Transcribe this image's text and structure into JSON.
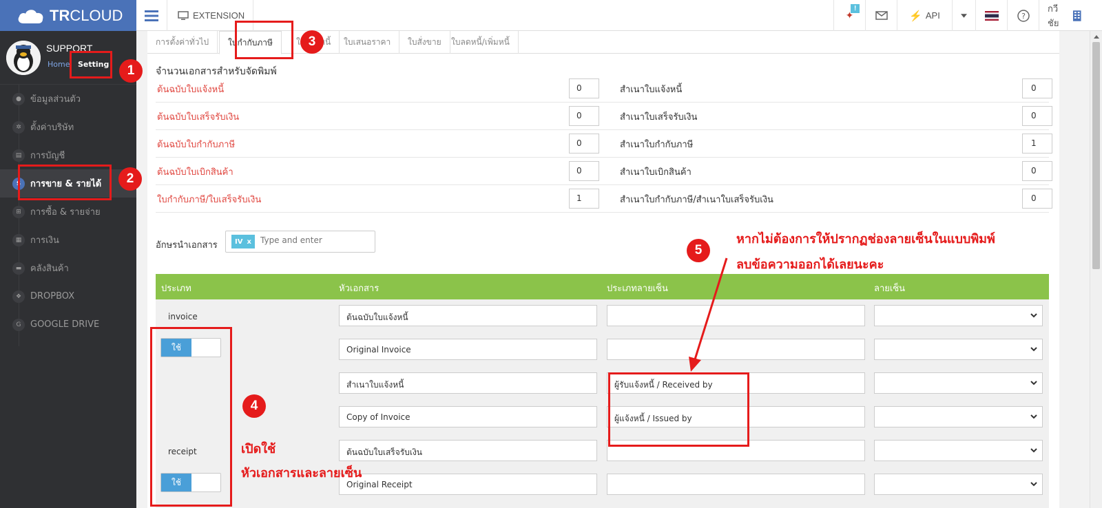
{
  "brand": {
    "logo_bold": "TR",
    "logo_rest": "CLOUD"
  },
  "topbar": {
    "extension_label": "EXTENSION",
    "notification_count": "!",
    "api_label": "API",
    "user_name": "กวีชัย"
  },
  "sidebar": {
    "profile_name": "SUPPORT",
    "home_link": "Home",
    "setting_link": "Setting",
    "items": [
      {
        "label": "ข้อมูลส่วนตัว",
        "icon": "user-icon",
        "glyph": "●"
      },
      {
        "label": "ตั้งค่าบริษัท",
        "icon": "gear-icon",
        "glyph": "✲"
      },
      {
        "label": "การบัญชี",
        "icon": "book-icon",
        "glyph": "▤"
      },
      {
        "label": "การขาย & รายได้",
        "icon": "dollar-icon",
        "glyph": "$",
        "active": true
      },
      {
        "label": "การซื้อ & รายจ่าย",
        "icon": "cart-icon",
        "glyph": "⊞"
      },
      {
        "label": "การเงิน",
        "icon": "calendar-icon",
        "glyph": "▦"
      },
      {
        "label": "คลังสินค้า",
        "icon": "truck-icon",
        "glyph": "▬"
      },
      {
        "label": "DROPBOX",
        "icon": "dropbox-icon",
        "glyph": "❖"
      },
      {
        "label": "GOOGLE DRIVE",
        "icon": "google-icon",
        "glyph": "G"
      }
    ]
  },
  "tabs": [
    {
      "label": "การตั้งค่าทั่วไป"
    },
    {
      "label": "ใบกำกับภาษี",
      "active": true
    },
    {
      "label": "ใบแจ้งหนี้"
    },
    {
      "label": "ใบเสนอราคา"
    },
    {
      "label": "ใบสั่งขาย"
    },
    {
      "label": "ใบลดหนี้/เพิ่มหนี้"
    }
  ],
  "print_section": {
    "title": "จำนวนเอกสารสำหรับจัดพิมพ์",
    "rows": [
      {
        "label": "ต้นฉบับใบแจ้งหนี้",
        "value": "0",
        "copy_label": "สำเนาใบแจ้งหนี้",
        "copy_value": "0"
      },
      {
        "label": "ต้นฉบับใบเสร็จรับเงิน",
        "value": "0",
        "copy_label": "สำเนาใบเสร็จรับเงิน",
        "copy_value": "0"
      },
      {
        "label": "ต้นฉบับใบกำกับภาษี",
        "value": "0",
        "copy_label": "สำเนาใบกำกับภาษี",
        "copy_value": "1"
      },
      {
        "label": "ต้นฉบับใบเบิกสินค้า",
        "value": "0",
        "copy_label": "สำเนาใบเบิกสินค้า",
        "copy_value": "0"
      },
      {
        "label": "ใบกำกับภาษี/ใบเสร็จรับเงิน",
        "value": "1",
        "copy_label": "สำเนาใบกำกับภาษี/สำเนาใบเสร็จรับเงิน",
        "copy_value": "0"
      }
    ]
  },
  "prefix": {
    "label": "อักษรนำเอกสาร",
    "tag": "IV",
    "tag_remove": "x",
    "placeholder": "Type and enter"
  },
  "table": {
    "headers": [
      "ประเภท",
      "หัวเอกสาร",
      "ประเภทลายเซ็น",
      "ลายเซ็น"
    ],
    "toggle_label": "ใช้",
    "groups": [
      {
        "type": "invoice",
        "headers": [
          "ต้นฉบับใบแจ้งหนี้",
          "Original Invoice",
          "สำเนาใบแจ้งหนี้",
          "Copy of Invoice"
        ],
        "signatures": [
          "",
          "",
          "ผู้รับแจ้งหนี้ / Received by",
          "ผู้แจ้งหนี้ / Issued by"
        ]
      },
      {
        "type": "receipt",
        "headers": [
          "ต้นฉบับใบเสร็จรับเงิน",
          "Original Receipt"
        ],
        "signatures": [
          "",
          ""
        ]
      }
    ]
  },
  "annotations": {
    "badges": [
      "1",
      "2",
      "3",
      "4",
      "5"
    ],
    "note4_line1": "เปิดใช้",
    "note4_line2": "หัวเอกสารและลายเซ็น",
    "note5_line1": "หากไม่ต้องการให้ปรากฏช่องลายเซ็นในแบบพิมพ์",
    "note5_line2": "ลบข้อความออกได้เลยนะคะ",
    "color": "#e51b1b"
  },
  "colors": {
    "brand": "#4a72b8",
    "sidebar": "#2f3033",
    "table_header": "#8bc34a",
    "link_red": "#e0453e",
    "toggle_on": "#4a9fd8"
  }
}
